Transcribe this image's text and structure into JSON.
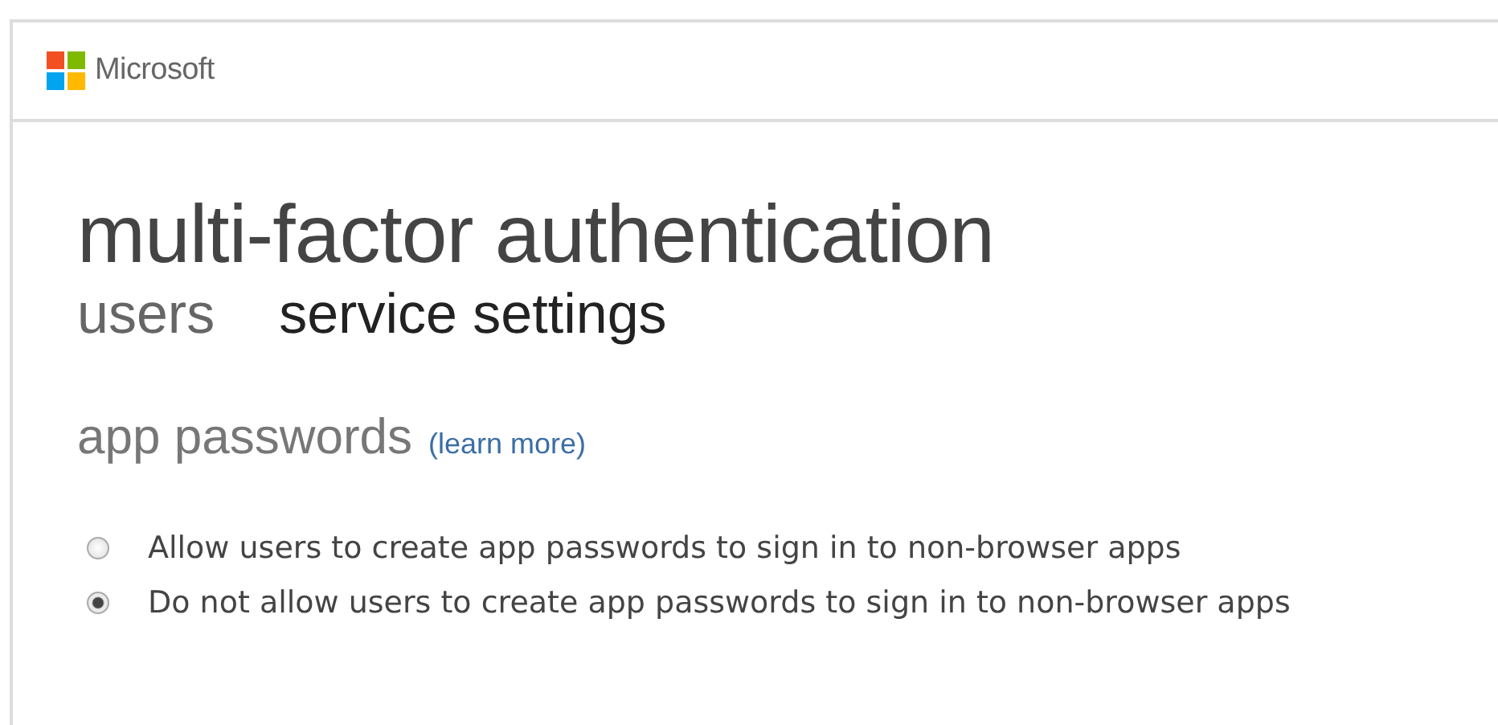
{
  "header": {
    "brand": "Microsoft"
  },
  "page": {
    "title": "multi-factor authentication"
  },
  "tabs": [
    {
      "label": "users",
      "selected": false
    },
    {
      "label": "service settings",
      "selected": true
    }
  ],
  "section": {
    "title": "app passwords",
    "link": "(learn more)"
  },
  "options": [
    {
      "label": "Allow users to create app passwords to sign in to non-browser apps",
      "selected": false
    },
    {
      "label": "Do not allow users to create app passwords to sign in to non-browser apps",
      "selected": true
    }
  ]
}
